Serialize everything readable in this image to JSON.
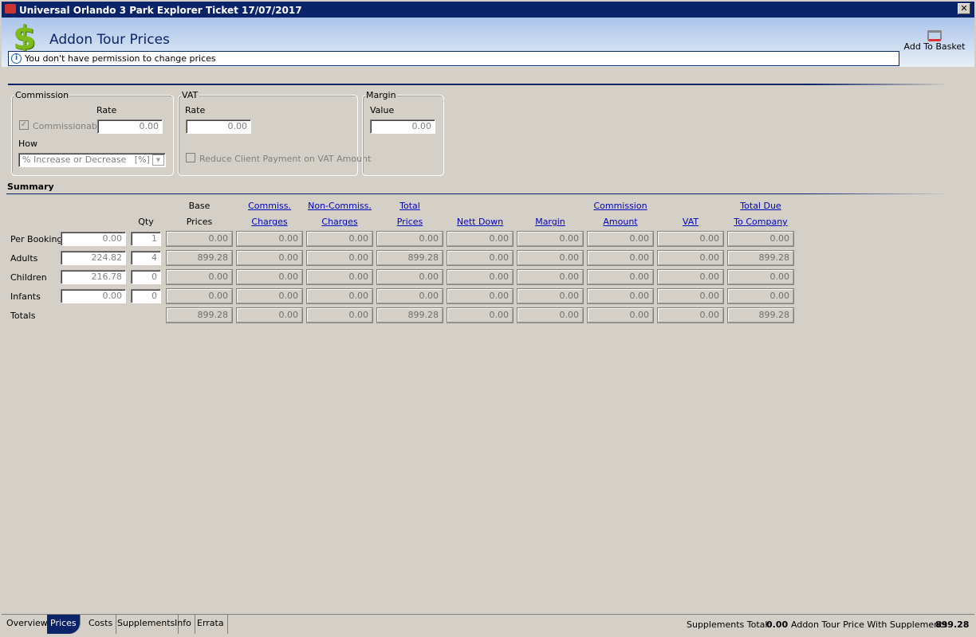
{
  "window": {
    "title": "Universal Orlando 3 Park Explorer Ticket 17/07/2017",
    "close": "✕"
  },
  "header": {
    "title": "Addon Tour Prices",
    "info": "You don't have permission to change prices",
    "add_to_basket": "Add To Basket"
  },
  "commission": {
    "legend": "Commission",
    "rate_label": "Rate",
    "rate": "0.00",
    "commissionable_label": "Commissionable",
    "commissionable": true,
    "how_label": "How",
    "how": "% Increase or Decrease   [%]"
  },
  "vat": {
    "legend": "VAT",
    "rate_label": "Rate",
    "rate": "0.00",
    "reduce_label": "Reduce Client Payment on VAT Amount",
    "reduce": false
  },
  "margin": {
    "legend": "Margin",
    "value_label": "Value",
    "value": "0.00"
  },
  "summary": {
    "title": "Summary",
    "headers": [
      [
        "",
        ""
      ],
      [
        "",
        "Qty"
      ],
      [
        "Base",
        "Prices"
      ],
      [
        "Commiss.",
        "Charges"
      ],
      [
        "Non-Commiss.",
        "Charges"
      ],
      [
        "Total",
        "Prices"
      ],
      [
        "",
        "Nett Down"
      ],
      [
        "",
        "Margin"
      ],
      [
        "Commission",
        "Amount"
      ],
      [
        "",
        "VAT"
      ],
      [
        "Total Due",
        "To Company"
      ]
    ],
    "rows": [
      {
        "label": "Per Booking",
        "values": [
          "0.00",
          "1",
          "0.00",
          "0.00",
          "0.00",
          "0.00",
          "0.00",
          "0.00",
          "0.00",
          "0.00",
          "0.00"
        ]
      },
      {
        "label": "Adults",
        "values": [
          "224.82",
          "4",
          "899.28",
          "0.00",
          "0.00",
          "899.28",
          "0.00",
          "0.00",
          "0.00",
          "0.00",
          "899.28"
        ]
      },
      {
        "label": "Children",
        "values": [
          "216.78",
          "0",
          "0.00",
          "0.00",
          "0.00",
          "0.00",
          "0.00",
          "0.00",
          "0.00",
          "0.00",
          "0.00"
        ]
      },
      {
        "label": "Infants",
        "values": [
          "0.00",
          "0",
          "0.00",
          "0.00",
          "0.00",
          "0.00",
          "0.00",
          "0.00",
          "0.00",
          "0.00",
          "0.00"
        ]
      },
      {
        "label": "Totals",
        "values": [
          "",
          "",
          "899.28",
          "0.00",
          "0.00",
          "899.28",
          "0.00",
          "0.00",
          "0.00",
          "0.00",
          "899.28"
        ]
      }
    ]
  },
  "tabs": [
    {
      "label": "Overview"
    },
    {
      "label": "Prices",
      "active": true
    },
    {
      "label": "Costs"
    },
    {
      "label": "Supplements"
    },
    {
      "label": "Info"
    },
    {
      "label": "Errata"
    }
  ],
  "status": {
    "supplements_label": "Supplements Total:",
    "supplements_value": "0.00",
    "total_label": "Addon Tour Price With Supplements:",
    "total_value": "899.28"
  }
}
